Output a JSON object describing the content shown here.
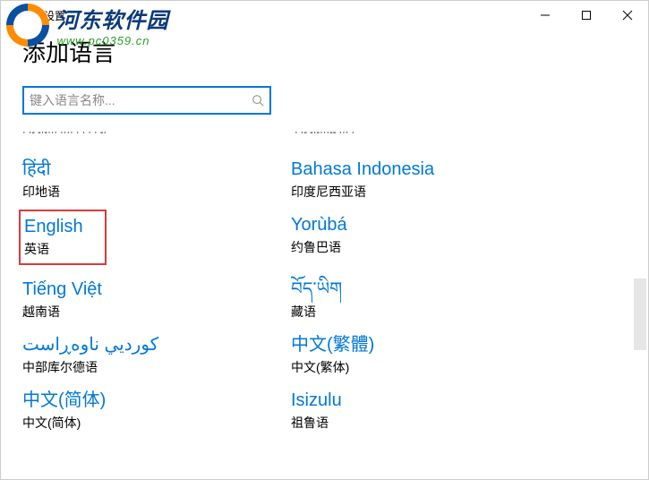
{
  "titlebar": {
    "title": "设置"
  },
  "page": {
    "heading": "添加语言"
  },
  "search": {
    "placeholder": "键入语言名称..."
  },
  "truncated": {
    "left": "· ·- -·-··· ···· · · · · -·",
    "right": "· ·- -·-···-- ··· ·"
  },
  "languages": [
    {
      "native": "हिंदी",
      "local": "印地语",
      "highlight": false
    },
    {
      "native": "Bahasa Indonesia",
      "local": "印度尼西亚语",
      "highlight": false
    },
    {
      "native": "English",
      "local": "英语",
      "highlight": true
    },
    {
      "native": "Yorùbá",
      "local": "约鲁巴语",
      "highlight": false
    },
    {
      "native": "Tiếng Việt",
      "local": "越南语",
      "highlight": false
    },
    {
      "native": "བོད་ཡིག",
      "local": "藏语",
      "highlight": false
    },
    {
      "native": "كورديي ناوەڕاست",
      "local": "中部库尔德语",
      "highlight": false
    },
    {
      "native": "中文(繁體)",
      "local": "中文(繁体)",
      "highlight": false
    },
    {
      "native": "中文(简体)",
      "local": "中文(简体)",
      "highlight": false
    },
    {
      "native": "Isizulu",
      "local": "祖鲁语",
      "highlight": false
    }
  ],
  "watermark": {
    "line1": "河东软件园",
    "line2": "www.pc0359.cn"
  }
}
